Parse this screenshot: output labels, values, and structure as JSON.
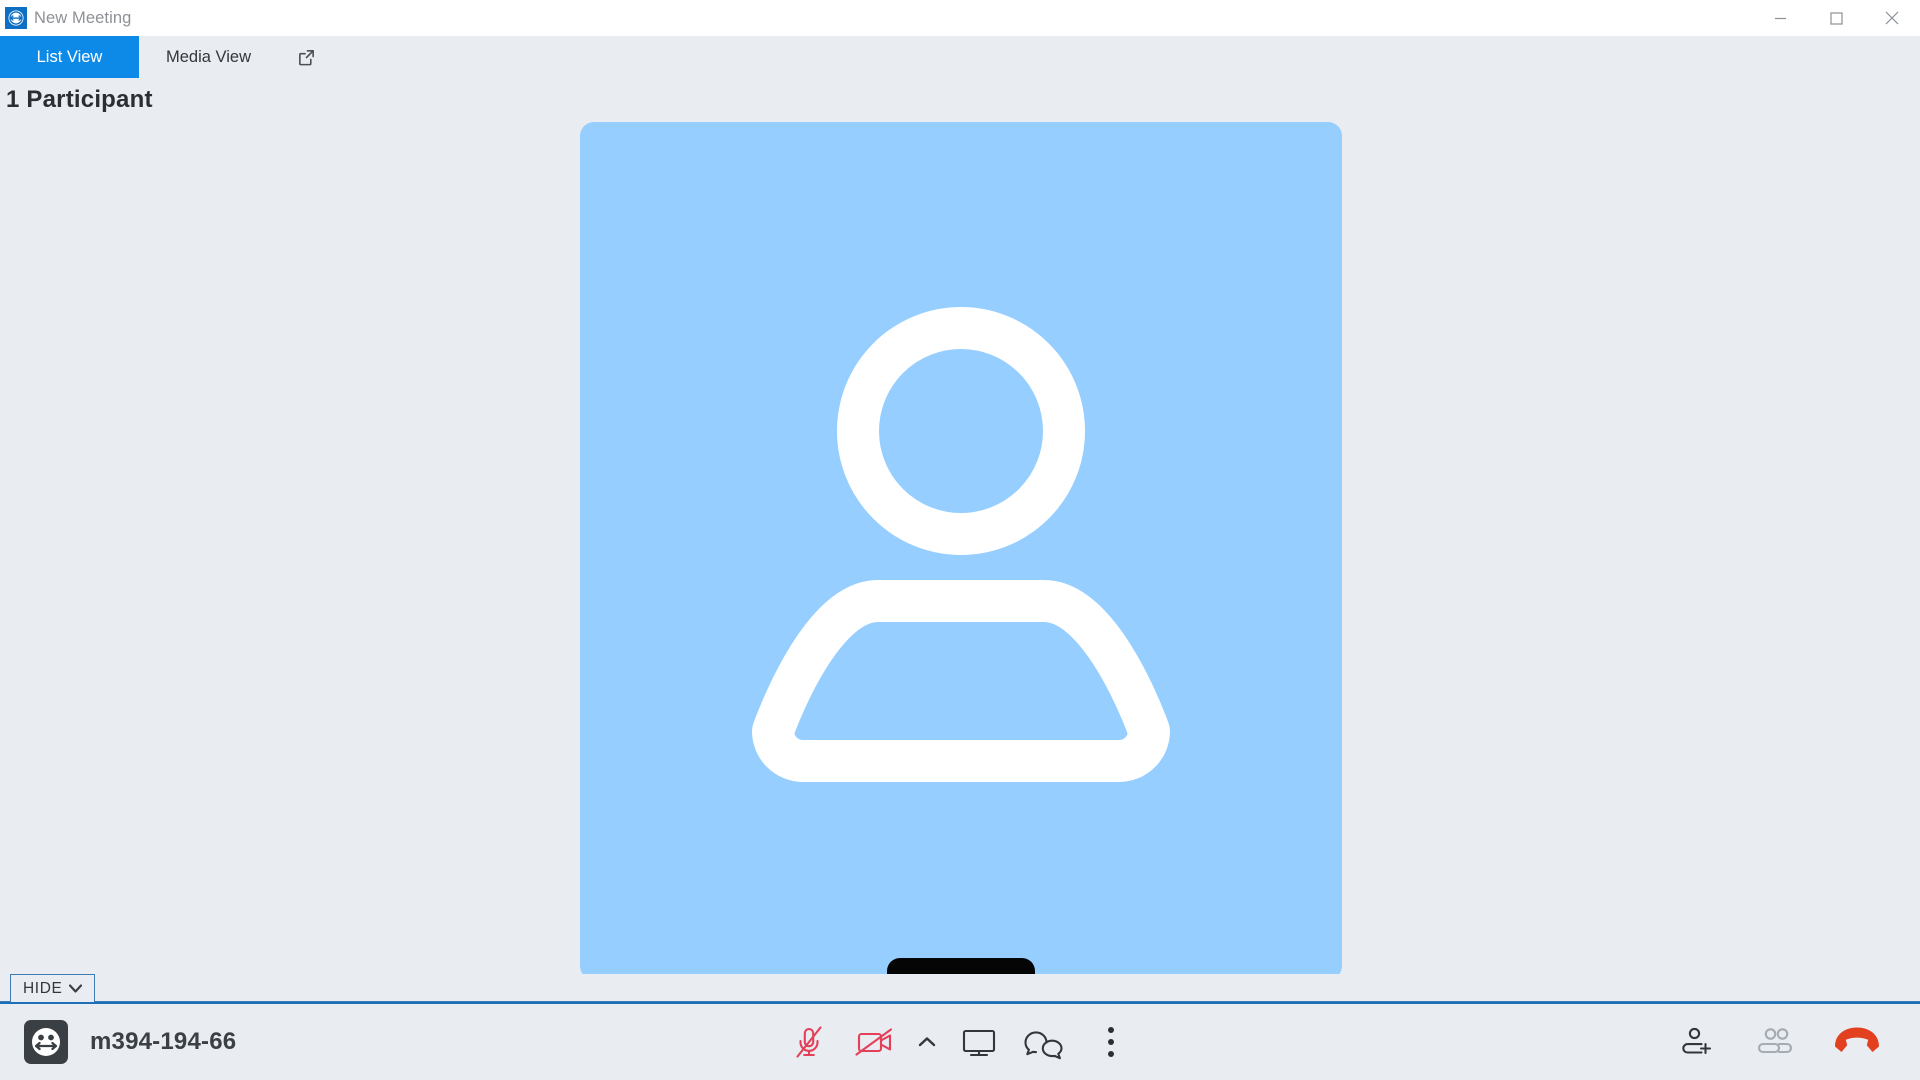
{
  "window": {
    "title": "New Meeting",
    "logo_icon": "teamviewer-logo-icon",
    "minimize_label": "Minimize",
    "maximize_label": "Maximize",
    "close_label": "Close"
  },
  "tabs": {
    "items": [
      {
        "label": "List View",
        "active": true
      },
      {
        "label": "Media View",
        "active": false
      }
    ],
    "popout_icon": "external-link-icon"
  },
  "main": {
    "participant_count_label": "1 Participant",
    "avatar": {
      "icon": "person-avatar-icon",
      "background_color": "#95ceff",
      "name_redacted": true
    }
  },
  "panel_toggle": {
    "label": "HIDE",
    "chevron_icon": "chevron-down-icon"
  },
  "toolbar": {
    "meeting_icon": "meeting-participants-icon",
    "meeting_id": "m394-194-66",
    "controls": [
      {
        "name": "microphone-muted-icon",
        "label": "Microphone",
        "state": "muted",
        "color": "#e4405a"
      },
      {
        "name": "camera-off-icon",
        "label": "Camera",
        "state": "off",
        "color": "#e4405a"
      },
      {
        "name": "chevron-up-icon",
        "label": "Media options",
        "color": "#33373b"
      },
      {
        "name": "screen-share-icon",
        "label": "Share screen",
        "color": "#33373b"
      },
      {
        "name": "chat-icon",
        "label": "Chat",
        "color": "#33373b"
      },
      {
        "name": "more-options-icon",
        "label": "More options",
        "color": "#33373b"
      }
    ],
    "right_controls": [
      {
        "name": "add-participant-icon",
        "label": "Invite participant",
        "color": "#33373b"
      },
      {
        "name": "participants-icon",
        "label": "Participants",
        "color": "#a4abb3",
        "disabled": true
      },
      {
        "name": "hang-up-icon",
        "label": "Leave meeting",
        "color": "#e2401f"
      }
    ]
  },
  "colors": {
    "accent_blue": "#0d8ae8",
    "window_bg": "#e9ecf1",
    "titlebar_bg": "#ffffff",
    "danger_red": "#e4405a",
    "hangup_red": "#e2401f",
    "separator_blue": "#1d6fb8"
  }
}
